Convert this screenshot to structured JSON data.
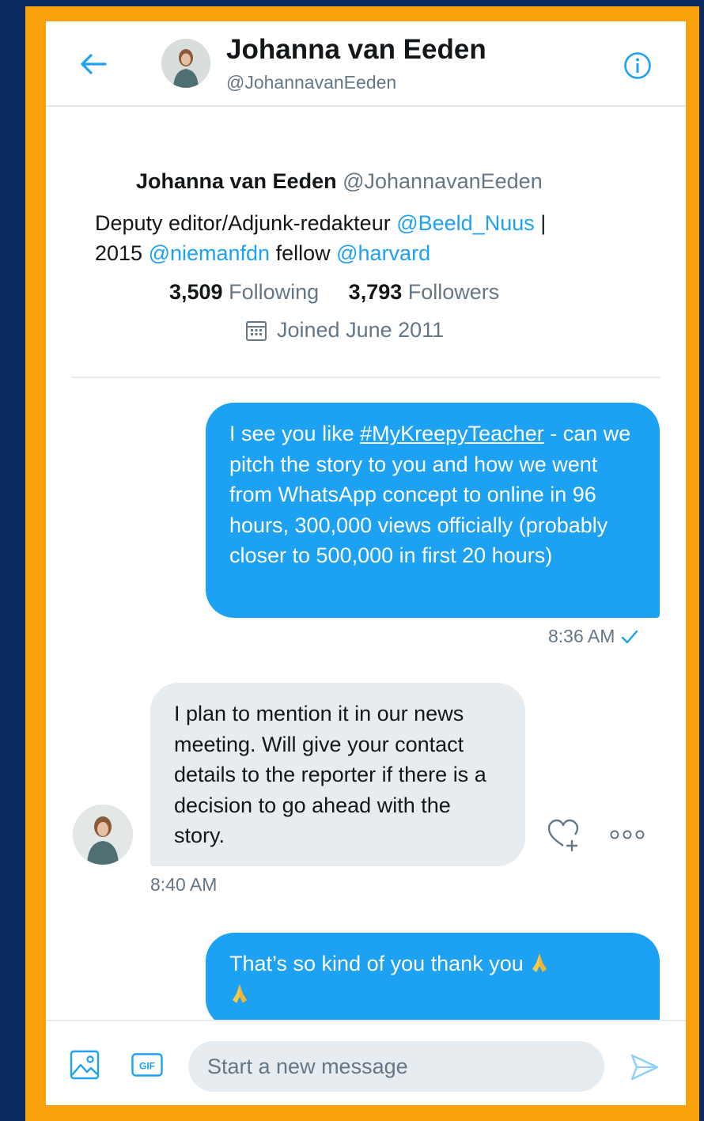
{
  "header": {
    "name": "Johanna van Eeden",
    "handle": "@JohannavanEeden"
  },
  "profile": {
    "name": "Johanna van Eeden",
    "handle": "@JohannavanEeden",
    "bio_line1_prefix": "Deputy editor/Adjunk-redakteur ",
    "bio_mention1": "@Beeld_Nuus",
    "bio_line1_suffix": " |",
    "bio_line2_prefix": "2015 ",
    "bio_mention2": "@niemanfdn",
    "bio_middle": " fellow ",
    "bio_mention3": "@harvard",
    "following_count": "3,509",
    "following_label": "Following",
    "followers_count": "3,793",
    "followers_label": "Followers",
    "joined": "Joined June 2011"
  },
  "messages": [
    {
      "direction": "outgoing",
      "text_prefix": "I see you like ",
      "hashtag": "#MyKreepyTeacher",
      "text_rest": " - can we pitch the story to you and how we went from WhatsApp concept to online in 96 hours, 300,000 views officially (probably closer to 500,000 in first 20 hours)",
      "time": "8:36 AM"
    },
    {
      "direction": "incoming",
      "text": "I plan to mention it in our news meeting. Will give your contact details to the reporter if there is a decision to go ahead with the story.",
      "time": "8:40 AM"
    },
    {
      "direction": "outgoing",
      "text": "That’s so kind of you thank you"
    }
  ],
  "composer": {
    "placeholder": "Start a new message",
    "gif_label": "GIF"
  },
  "colors": {
    "accent": "#1da1f2",
    "frame": "#f9a00c",
    "background": "#0b2a5e",
    "incoming_bubble": "#e6ecf0"
  },
  "icons": [
    "back-arrow-icon",
    "info-icon",
    "calendar-icon",
    "check-icon",
    "like-add-icon",
    "more-icon",
    "image-icon",
    "gif-icon",
    "send-icon",
    "praying-hands-emoji"
  ]
}
